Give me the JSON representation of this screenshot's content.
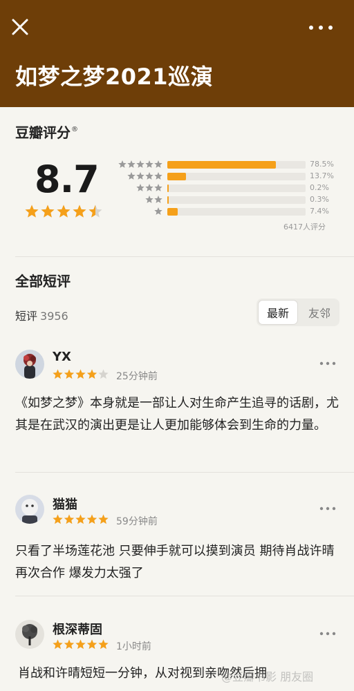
{
  "header": {
    "close_icon": "close-icon",
    "more_icon": "more-dots-icon",
    "title": "如梦之梦2021巡演",
    "background_color": "#6e3e08"
  },
  "rating": {
    "title": "豆瓣评分",
    "registered_mark": "®",
    "score": "8.7",
    "stars": 4.5,
    "distribution": [
      {
        "stars": 5,
        "percent_label": "78.5%",
        "fraction": 0.785
      },
      {
        "stars": 4,
        "percent_label": "13.7%",
        "fraction": 0.137
      },
      {
        "stars": 3,
        "percent_label": "0.2%",
        "fraction": 0.002
      },
      {
        "stars": 2,
        "percent_label": "0.3%",
        "fraction": 0.003
      },
      {
        "stars": 1,
        "percent_label": "7.4%",
        "fraction": 0.074
      }
    ],
    "total_count": "6417人评分",
    "accent_color": "#f5a01a"
  },
  "short_reviews": {
    "title": "全部短评",
    "label": "短评",
    "count": "3956",
    "sort_latest": "最新",
    "sort_friends": "友邻"
  },
  "reviews": [
    {
      "name": "YX",
      "stars": 4,
      "time": "25分钟前",
      "text": "《如梦之梦》本身就是一部让人对生命产生追寻的话剧，尤其是在武汉的演出更是让人更加能够体会到生命的力量。"
    },
    {
      "name": "猫猫",
      "stars": 5,
      "time": "59分钟前",
      "text": "只看了半场莲花池 只要伸手就可以摸到演员 期待肖战许晴再次合作 爆发力太强了"
    },
    {
      "name": "根深蒂固",
      "stars": 5,
      "time": "1小时前",
      "text": "肖战和许晴短短一分钟，从对视到亲吻然后拥"
    }
  ],
  "watermark": "@豆瓣书影 朋友圈"
}
